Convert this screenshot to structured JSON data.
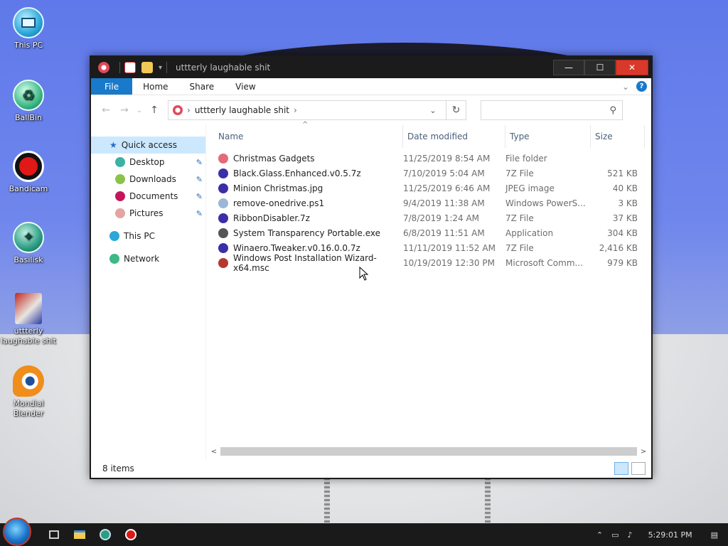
{
  "desktop_icons": [
    {
      "label": "This PC",
      "icon": "this-pc-icon"
    },
    {
      "label": "BallBin",
      "icon": "recycle-bin-icon"
    },
    {
      "label": "Bandicam",
      "icon": "bandicam-icon"
    },
    {
      "label": "Basilisk",
      "icon": "basilisk-icon"
    },
    {
      "label": "uttterly laughable shit",
      "icon": "folder-shortcut-icon"
    },
    {
      "label": "Mondial Blender",
      "icon": "blender-icon"
    }
  ],
  "window": {
    "title": "uttterly laughable shit",
    "controls": {
      "minimize": "—",
      "maximize": "☐",
      "close": "✕"
    }
  },
  "ribbon": {
    "tabs": [
      "File",
      "Home",
      "Share",
      "View"
    ],
    "help": "?",
    "expand": "⌄"
  },
  "address": {
    "path_segment": "uttterly laughable shit",
    "sep1": "›",
    "sep2": "›",
    "dropdown": "⌄",
    "refresh": "↻",
    "search_placeholder": ""
  },
  "nav": {
    "back": "←",
    "forward": "→",
    "recent": "⌄",
    "up": "↑"
  },
  "navpane": {
    "quick_access": "Quick access",
    "quick_items": [
      "Desktop",
      "Downloads",
      "Documents",
      "Pictures"
    ],
    "this_pc": "This PC",
    "network": "Network",
    "pin": "📌"
  },
  "columns": {
    "name": "Name",
    "date": "Date modified",
    "type": "Type",
    "size": "Size",
    "sort_arrow": "^"
  },
  "files": [
    {
      "name": "Christmas Gadgets",
      "date": "11/25/2019 8:54 AM",
      "type": "File folder",
      "size": "",
      "icon_color": "#e36a7c"
    },
    {
      "name": "Black.Glass.Enhanced.v0.5.7z",
      "date": "7/10/2019 5:04 AM",
      "type": "7Z File",
      "size": "521 KB",
      "icon_color": "#3a2fa8"
    },
    {
      "name": "Minion Christmas.jpg",
      "date": "11/25/2019 6:46 AM",
      "type": "JPEG image",
      "size": "40 KB",
      "icon_color": "#3a2fa8"
    },
    {
      "name": "remove-onedrive.ps1",
      "date": "9/4/2019 11:38 AM",
      "type": "Windows PowerS...",
      "size": "3 KB",
      "icon_color": "#9bb7d6"
    },
    {
      "name": "RibbonDisabler.7z",
      "date": "7/8/2019 1:24 AM",
      "type": "7Z File",
      "size": "37 KB",
      "icon_color": "#3a2fa8"
    },
    {
      "name": "System Transparency Portable.exe",
      "date": "6/8/2019 11:51 AM",
      "type": "Application",
      "size": "304 KB",
      "icon_color": "#555555"
    },
    {
      "name": "Winaero.Tweaker.v0.16.0.0.7z",
      "date": "11/11/2019 11:52 AM",
      "type": "7Z File",
      "size": "2,416 KB",
      "icon_color": "#3a2fa8"
    },
    {
      "name": "Windows Post Installation Wizard-x64.msc",
      "date": "10/19/2019 12:30 PM",
      "type": "Microsoft Comm...",
      "size": "979 KB",
      "icon_color": "#b5392f"
    }
  ],
  "status": {
    "items": "8 items"
  },
  "scroll": {
    "left": "<",
    "right": ">"
  },
  "tray": {
    "time": "5:29:01 PM"
  },
  "colors": {
    "accent": "#1979ca",
    "selected": "#cce8ff",
    "close": "#d9392a"
  }
}
